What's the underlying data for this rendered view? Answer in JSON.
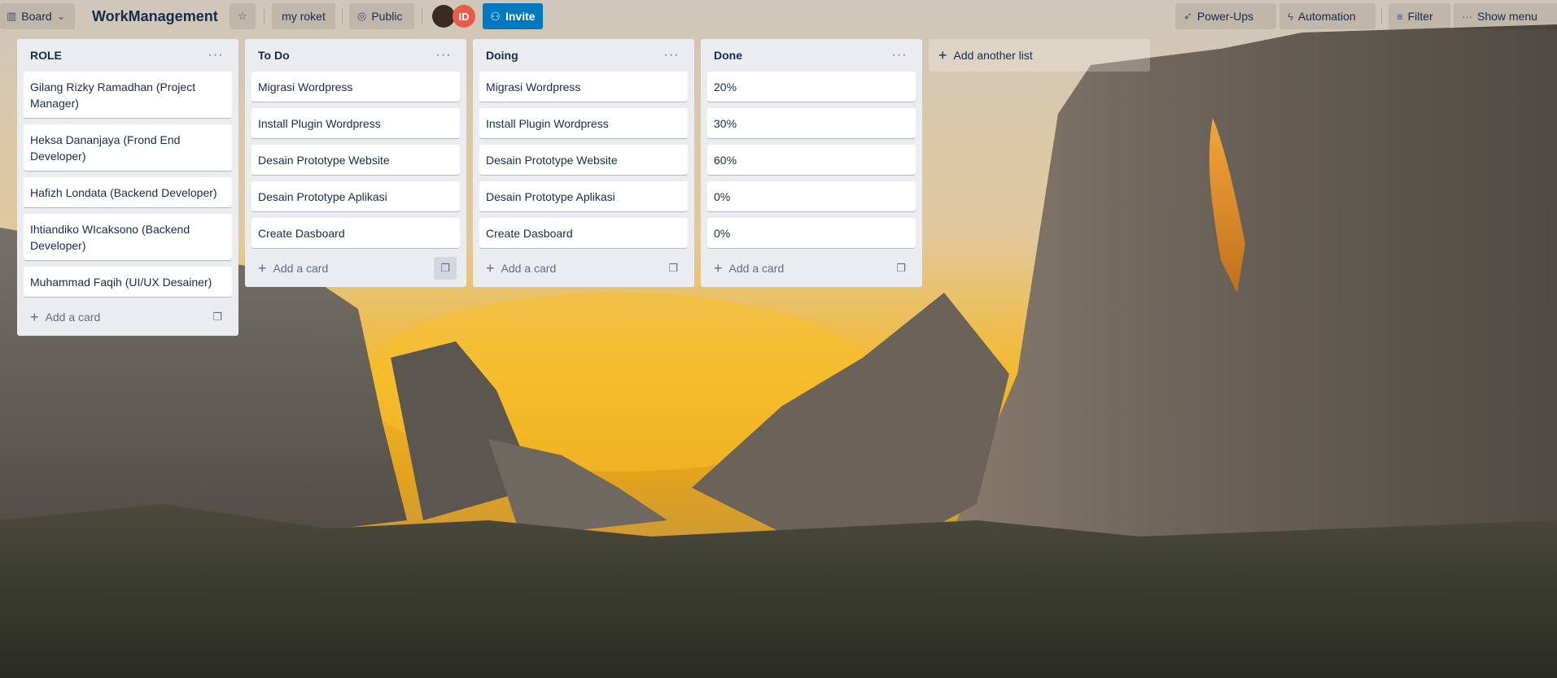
{
  "header": {
    "board_view_label": "Board",
    "board_title": "WorkManagement",
    "workspace_label": "my roket",
    "visibility_label": "Public",
    "avatar_initials": "ID",
    "invite_label": "Invite",
    "powerups_label": "Power-Ups",
    "automation_label": "Automation",
    "filter_label": "Filter",
    "show_menu_label": "Show menu"
  },
  "lists": [
    {
      "title": "ROLE",
      "cards": [
        "Gilang Rizky Ramadhan (Project Manager)",
        "Heksa Dananjaya (Frond End Developer)",
        "Hafizh Londata (Backend Developer)",
        "Ihtiandiko WIcaksono (Backend Developer)",
        "Muhammad Faqih (UI/UX Desainer)"
      ],
      "add_card_label": "Add a card"
    },
    {
      "title": "To Do",
      "cards": [
        "Migrasi Wordpress",
        "Install Plugin Wordpress",
        "Desain Prototype Website",
        "Desain Prototype Aplikasi",
        "Create Dasboard"
      ],
      "add_card_label": "Add a card"
    },
    {
      "title": "Doing",
      "cards": [
        "Migrasi Wordpress",
        "Install Plugin Wordpress",
        "Desain Prototype Website",
        "Desain Prototype Aplikasi",
        "Create Dasboard"
      ],
      "add_card_label": "Add a card"
    },
    {
      "title": "Done",
      "cards": [
        "20%",
        "30%",
        "60%",
        "0%",
        "0%"
      ],
      "add_card_label": "Add a card"
    }
  ],
  "add_list_label": "Add another list",
  "icons": {
    "board": "board-icon",
    "chevron": "chevron-down-icon",
    "star": "star-icon",
    "globe": "globe-icon",
    "invite": "add-member-icon",
    "rocket": "rocket-icon",
    "bolt": "bolt-icon",
    "filter": "filter-icon",
    "more": "more-icon",
    "plus": "plus-icon",
    "template": "card-template-icon"
  },
  "colors": {
    "invite_bg": "#0079bf",
    "avatar_id_bg": "#eb5a46",
    "list_bg": "#ebecf0"
  }
}
